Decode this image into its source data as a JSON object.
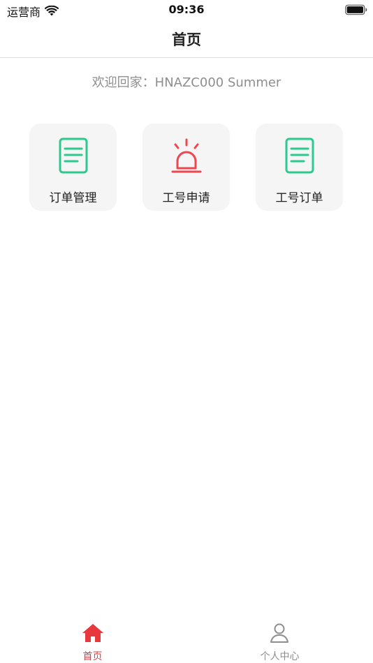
{
  "status_bar": {
    "carrier": "运营商",
    "time": "09:36",
    "wifi_icon": "wifi-icon",
    "battery_icon": "battery-icon"
  },
  "nav": {
    "title": "首页"
  },
  "welcome": {
    "text": "欢迎回家：HNAZC000 Summer"
  },
  "tiles": [
    {
      "label": "订单管理",
      "icon": "document-icon",
      "color": "#2dc98e"
    },
    {
      "label": "工号申请",
      "icon": "alarm-icon",
      "color": "#f0464f"
    },
    {
      "label": "工号订单",
      "icon": "document-icon",
      "color": "#2dc98e"
    }
  ],
  "tab_bar": {
    "tabs": [
      {
        "label": "首页",
        "icon": "home-icon",
        "active": true
      },
      {
        "label": "个人中心",
        "icon": "person-icon",
        "active": false
      }
    ],
    "active_color": "#e8373d",
    "inactive_color": "#8e8e8e"
  }
}
